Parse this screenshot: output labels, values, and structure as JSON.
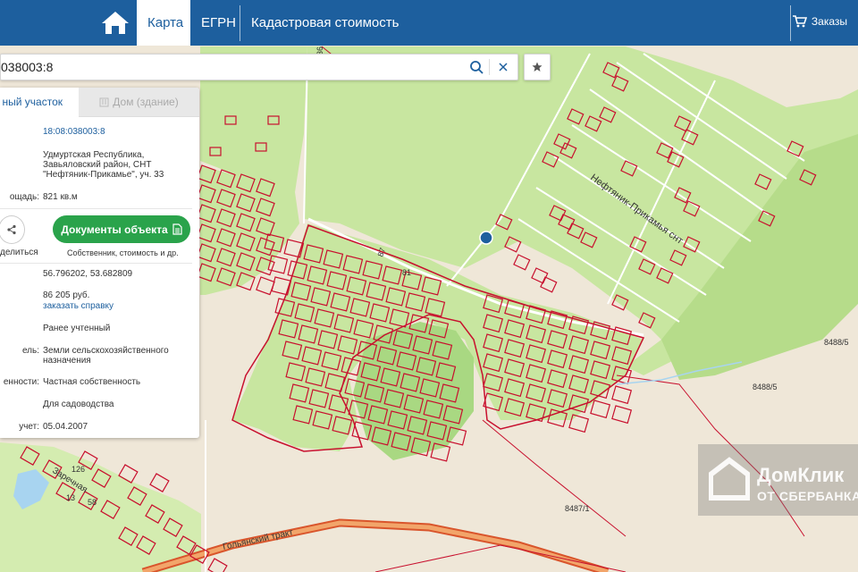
{
  "nav": {
    "home_icon": "home-icon",
    "tabs": [
      {
        "label": "Карта",
        "active": true
      },
      {
        "label": "ЕГРН",
        "active": false
      },
      {
        "label": "Кадастровая стоимость",
        "active": false
      }
    ],
    "orders_label": "Заказы",
    "orders_icon": "cart-icon"
  },
  "search": {
    "value": "038003:8",
    "search_icon": "search-icon",
    "clear_icon": "close-icon",
    "favorite_icon": "star-icon"
  },
  "panel": {
    "tabs": [
      {
        "label": "ный участок",
        "active": true
      },
      {
        "label": "Дом (здание)",
        "active": false
      }
    ],
    "cadastral_number": "18:08:038003:8",
    "address_line1": "Удмуртская Республика,",
    "address_line2": "Завьяловский район, СНТ",
    "address_line3": "\"Нефтяник-Прикамье\", уч. 33",
    "area_label": "ощадь:",
    "area_value": "821 кв.м",
    "share_label": "делиться",
    "docs_button": "Документы объекта",
    "docs_sub": "Собственник, стоимость и др.",
    "coordinates": "56.796202, 53.682809",
    "cost_value": "86 205 руб.",
    "order_link": "заказать справку",
    "status_value": "Ранее учтенный",
    "category_label": "ель:",
    "category_line1": "Земли сельскохозяйственного",
    "category_line2": "назначения",
    "ownership_label": "енности:",
    "ownership_value": "Частная собственность",
    "use_value": "Для садоводства",
    "date_label": "учет:",
    "date_value": "05.04.2007"
  },
  "map": {
    "labels": {
      "street_snt": "Нефтяник-Прикамья снт",
      "street_zarechnaya": "Заречная",
      "road": "Гольянский тракт",
      "parcel_a": "8488/5",
      "parcel_b": "8488/5",
      "parcel_c": "8487/1",
      "num_126": "126",
      "num_58": "58",
      "num_13": "13",
      "num_81": "81",
      "num_87": "87",
      "num_36": "36"
    },
    "colors": {
      "green": "#c8e6a0",
      "light": "#efe7d8",
      "parcel": "#c8102e",
      "marker": "#1d5f9e"
    }
  },
  "watermark": {
    "line1": "ДомКлик",
    "line2": "ОТ СБЕРБАНКА"
  }
}
